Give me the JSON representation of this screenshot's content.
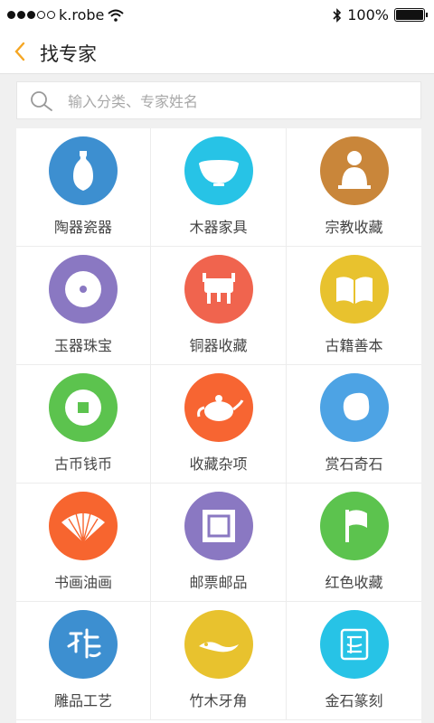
{
  "status_bar": {
    "carrier": "k.robe",
    "battery": "100%",
    "battery_level": 1.0
  },
  "nav": {
    "back_icon": "chevron-left-icon",
    "title": "找专家"
  },
  "search": {
    "placeholder": "输入分类、专家姓名"
  },
  "categories": [
    {
      "label": "陶器瓷器",
      "icon": "vase-icon",
      "color": "#3d8fd0"
    },
    {
      "label": "木器家具",
      "icon": "bowl-icon",
      "color": "#27c3e6"
    },
    {
      "label": "宗教收藏",
      "icon": "buddha-icon",
      "color": "#c9863a"
    },
    {
      "label": "玉器珠宝",
      "icon": "jade-disc-icon",
      "color": "#8a78c2"
    },
    {
      "label": "铜器收藏",
      "icon": "bronze-ding-icon",
      "color": "#f0644e"
    },
    {
      "label": "古籍善本",
      "icon": "book-icon",
      "color": "#e8c22e"
    },
    {
      "label": "古币钱币",
      "icon": "coin-icon",
      "color": "#5cc34e"
    },
    {
      "label": "收藏杂项",
      "icon": "teapot-icon",
      "color": "#f76532"
    },
    {
      "label": "赏石奇石",
      "icon": "stone-icon",
      "color": "#4da3e4"
    },
    {
      "label": "书画油画",
      "icon": "fan-icon",
      "color": "#f7652f"
    },
    {
      "label": "邮票邮品",
      "icon": "stamp-icon",
      "color": "#8a78c2"
    },
    {
      "label": "红色收藏",
      "icon": "flag-icon",
      "color": "#5cc34e"
    },
    {
      "label": "雕品工艺",
      "icon": "calligraphy-icon",
      "color": "#3d8fd0"
    },
    {
      "label": "竹木牙角",
      "icon": "horn-icon",
      "color": "#e8c22e"
    },
    {
      "label": "金石篆刻",
      "icon": "seal-icon",
      "color": "#27c3e6"
    }
  ]
}
